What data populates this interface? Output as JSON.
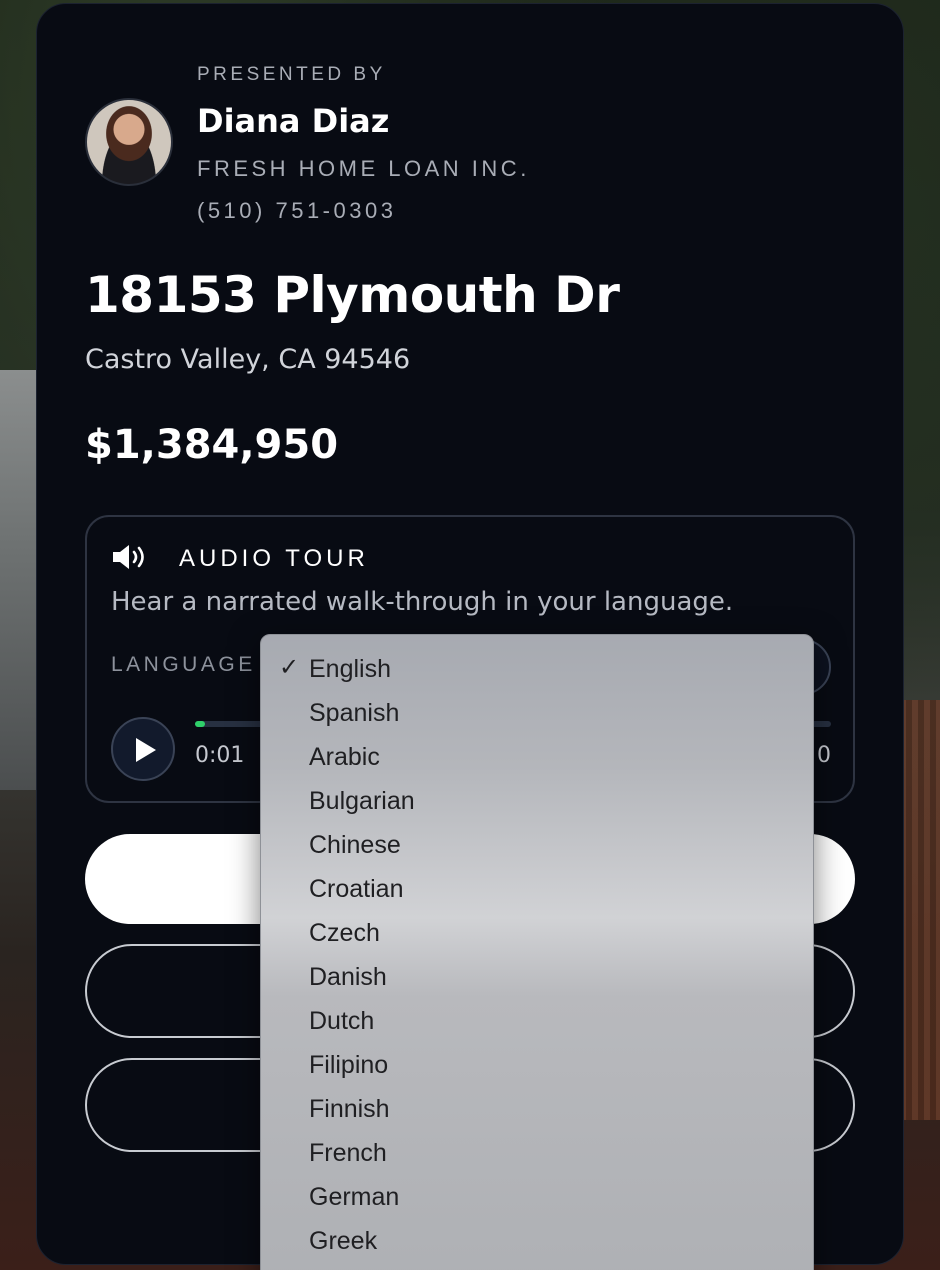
{
  "agent": {
    "presented_by": "PRESENTED BY",
    "name": "Diana Diaz",
    "company": "FRESH HOME LOAN INC.",
    "phone": "(510) 751-0303"
  },
  "property": {
    "address": "18153 Plymouth Dr",
    "city_state_zip": "Castro Valley, CA 94546",
    "price": "$1,384,950"
  },
  "audio_tour": {
    "title": "AUDIO TOUR",
    "description": "Hear a narrated walk-through in your language.",
    "language_label": "LANGUAGE",
    "current_time": "0:01",
    "total_time_partial": "0",
    "progress_fraction": 0.015
  },
  "language_menu": {
    "selected": "English",
    "options": [
      "English",
      "Spanish",
      "Arabic",
      "Bulgarian",
      "Chinese",
      "Croatian",
      "Czech",
      "Danish",
      "Dutch",
      "Filipino",
      "Finnish",
      "French",
      "German",
      "Greek"
    ]
  },
  "colors": {
    "progress": "#2fd06a",
    "card_bg": "#080b13"
  }
}
